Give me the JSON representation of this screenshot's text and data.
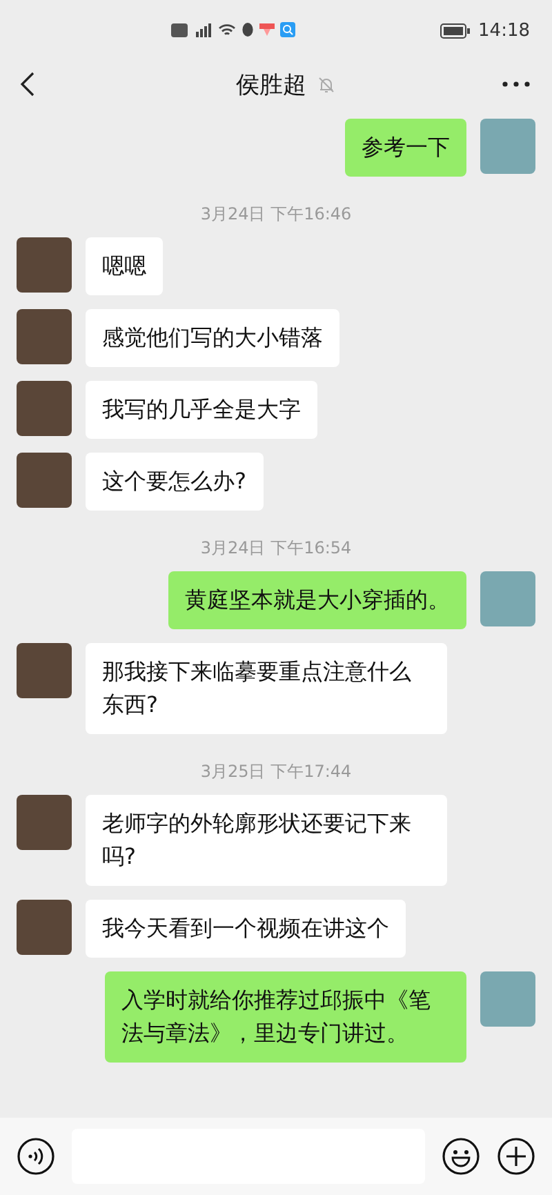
{
  "status_bar": {
    "time": "14:18"
  },
  "header": {
    "title": "侯胜超",
    "muted": true
  },
  "messages": [
    {
      "kind": "message",
      "outgoing": true,
      "text": "参考一下"
    },
    {
      "kind": "time",
      "text": "3月24日 下午16:46"
    },
    {
      "kind": "message",
      "outgoing": false,
      "text": "嗯嗯"
    },
    {
      "kind": "message",
      "outgoing": false,
      "text": "感觉他们写的大小错落"
    },
    {
      "kind": "message",
      "outgoing": false,
      "text": "我写的几乎全是大字"
    },
    {
      "kind": "message",
      "outgoing": false,
      "text": "这个要怎么办?"
    },
    {
      "kind": "time",
      "text": "3月24日 下午16:54"
    },
    {
      "kind": "message",
      "outgoing": true,
      "text": "黄庭坚本就是大小穿插的。"
    },
    {
      "kind": "message",
      "outgoing": false,
      "text": "那我接下来临摹要重点注意什么东西?"
    },
    {
      "kind": "time",
      "text": "3月25日 下午17:44"
    },
    {
      "kind": "message",
      "outgoing": false,
      "text": "老师字的外轮廓形状还要记下来吗?"
    },
    {
      "kind": "message",
      "outgoing": false,
      "text": "我今天看到一个视频在讲这个"
    },
    {
      "kind": "message",
      "outgoing": true,
      "text": "入学时就给你推荐过邱振中《笔法与章法》，里边专门讲过。"
    }
  ]
}
